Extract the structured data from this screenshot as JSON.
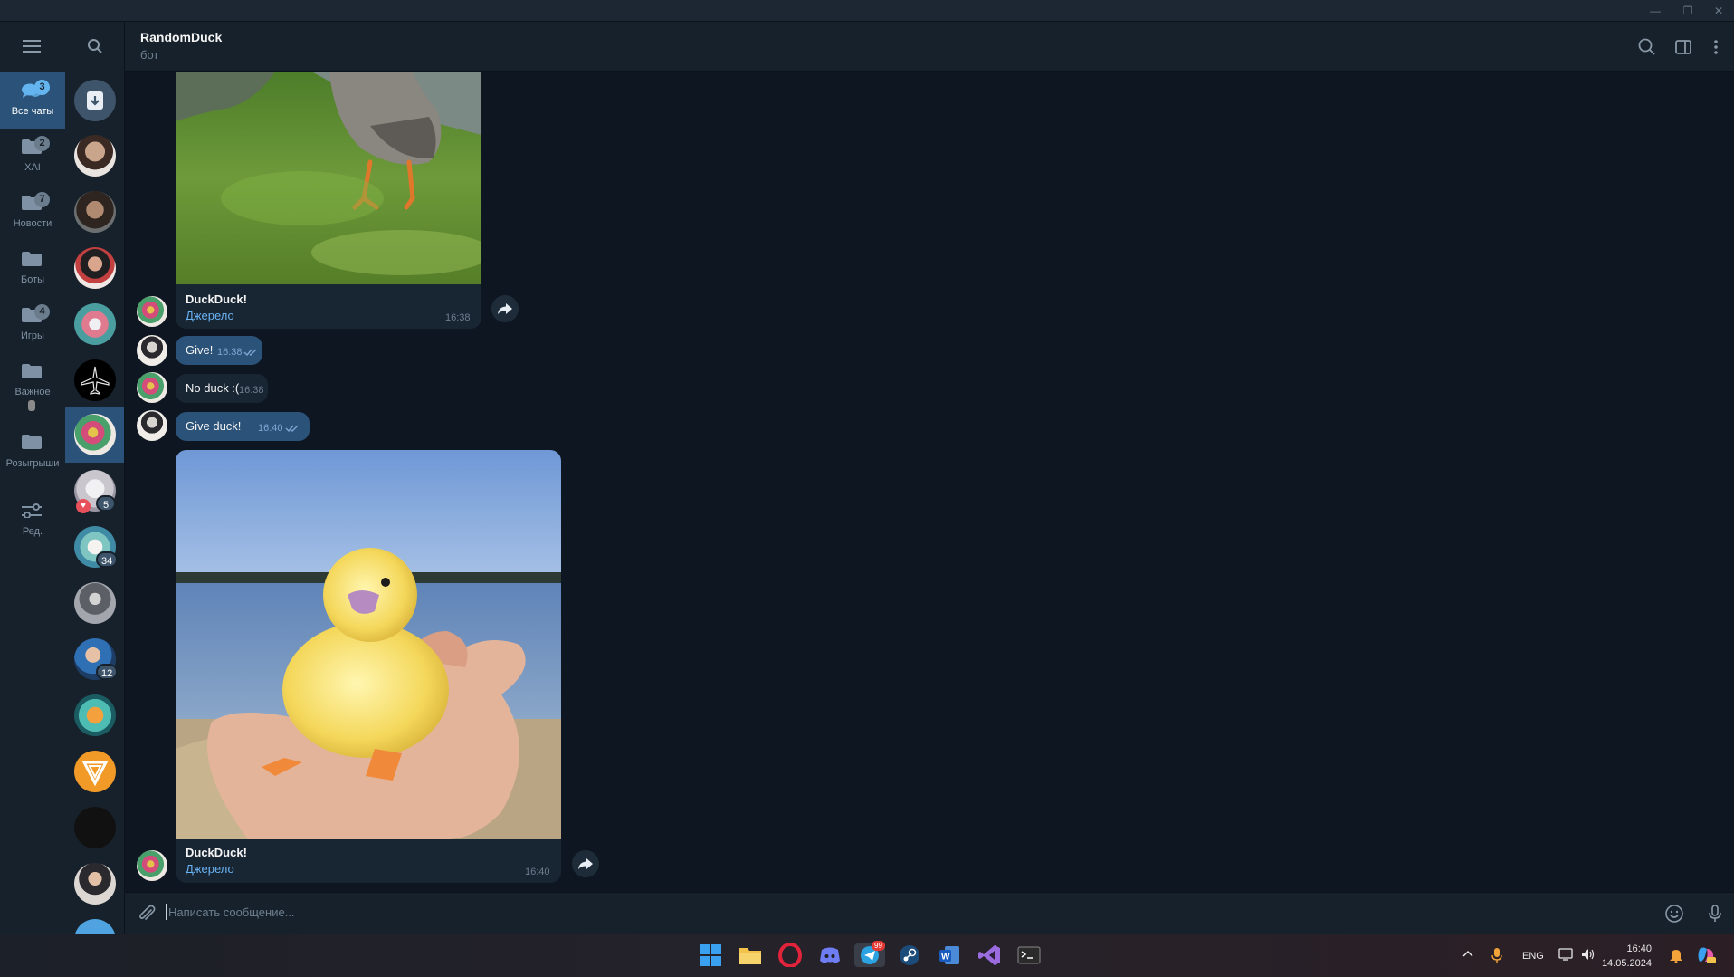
{
  "header": {
    "title": "RandomDuck",
    "subtitle": "бот"
  },
  "folders": [
    {
      "label": "Все чаты",
      "badge": "3",
      "active": true
    },
    {
      "label": "XAI",
      "badge": "2"
    },
    {
      "label": "Новости",
      "badge": "7"
    },
    {
      "label": "Боты",
      "badge": ""
    },
    {
      "label": "Игры",
      "badge": "4"
    },
    {
      "label": "Важное",
      "badge": ""
    },
    {
      "label": "Розыгрыши",
      "badge": ""
    },
    {
      "label": "Ред.",
      "badge": ""
    }
  ],
  "chatlist_badges": [
    "5",
    "34",
    "12"
  ],
  "messages": {
    "m1": {
      "caption_title": "DuckDuck!",
      "caption_link": "Джерело",
      "time": "16:38"
    },
    "m2": {
      "text": "Give!",
      "time": "16:38"
    },
    "m3": {
      "text": "No duck :(",
      "time": "16:38"
    },
    "m4": {
      "text": "Give duck!",
      "time": "16:40"
    },
    "m5": {
      "caption_title": "DuckDuck!",
      "caption_link": "Джерело",
      "time": "16:40"
    }
  },
  "composer": {
    "placeholder": "Написать сообщение..."
  },
  "taskbar": {
    "telegram_badge": "99",
    "lang": "ENG",
    "time": "16:40",
    "date": "14.05.2024"
  },
  "colors": {
    "accent": "#2b5278",
    "link": "#6ab3f3",
    "background": "#0e1621",
    "panel": "#17212b"
  }
}
